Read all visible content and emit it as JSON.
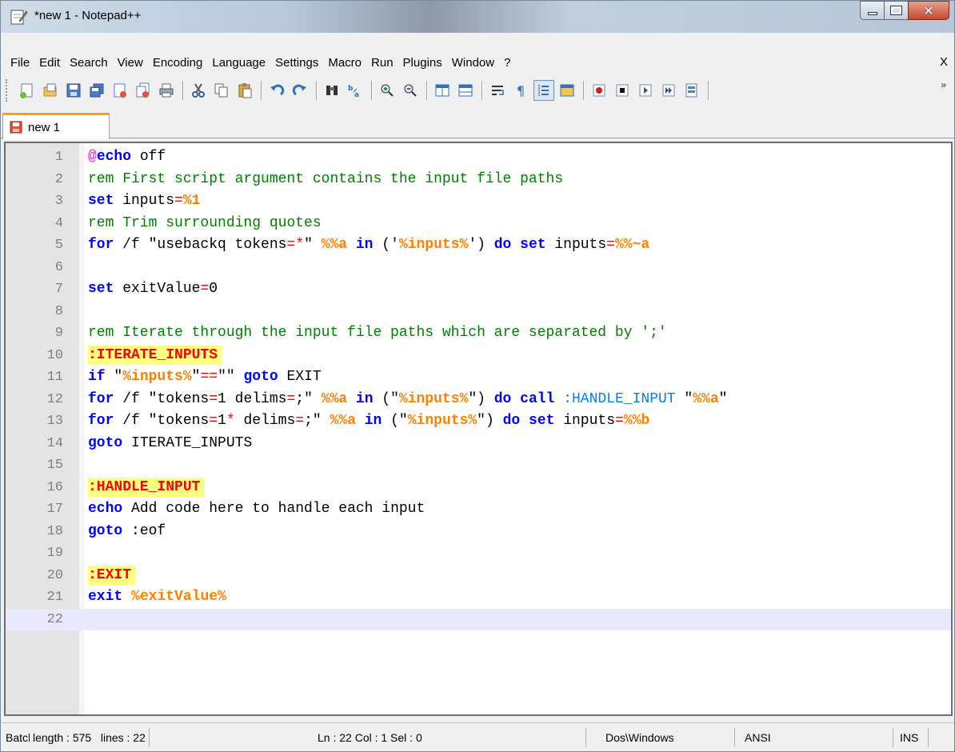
{
  "window": {
    "title": "*new 1 - Notepad++"
  },
  "menu": {
    "items": [
      "File",
      "Edit",
      "Search",
      "View",
      "Encoding",
      "Language",
      "Settings",
      "Macro",
      "Run",
      "Plugins",
      "Window",
      "?"
    ],
    "close": "X"
  },
  "toolbar": {
    "icons": [
      "new-file-icon",
      "open-file-icon",
      "save-icon",
      "save-all-icon",
      "close-icon",
      "close-all-icon",
      "print-icon",
      "cut-icon",
      "copy-icon",
      "paste-icon",
      "undo-icon",
      "redo-icon",
      "find-icon",
      "replace-icon",
      "zoom-in-icon",
      "zoom-out-icon",
      "sync-vertical-icon",
      "sync-horizontal-icon",
      "word-wrap-icon",
      "show-all-chars-icon",
      "indent-guide-icon",
      "document-map-icon",
      "record-macro-icon",
      "stop-record-icon",
      "playback-macro-icon",
      "run-macro-multiple-icon",
      "save-macro-icon"
    ],
    "more": "»"
  },
  "tab": {
    "label": "new 1"
  },
  "editor": {
    "lines": [
      {
        "n": "1"
      },
      {
        "n": "2"
      },
      {
        "n": "3"
      },
      {
        "n": "4"
      },
      {
        "n": "5"
      },
      {
        "n": "6"
      },
      {
        "n": "7"
      },
      {
        "n": "8"
      },
      {
        "n": "9"
      },
      {
        "n": "10"
      },
      {
        "n": "11"
      },
      {
        "n": "12"
      },
      {
        "n": "13"
      },
      {
        "n": "14"
      },
      {
        "n": "15"
      },
      {
        "n": "16"
      },
      {
        "n": "17"
      },
      {
        "n": "18"
      },
      {
        "n": "19"
      },
      {
        "n": "20"
      },
      {
        "n": "21"
      },
      {
        "n": "22"
      }
    ],
    "code": {
      "l1_at": "@",
      "l1_kw": "echo",
      "l1_rest": " off",
      "l2": "rem First script argument contains the input file paths",
      "l3_kw": "set",
      "l3_a": " inputs",
      "l3_op": "=",
      "l3_var": "%1",
      "l4": "rem Trim surrounding quotes",
      "l5_kw1": "for",
      "l5_a": " /f \"usebackq tokens",
      "l5_op1": "=*",
      "l5_b": "\" ",
      "l5_var1": "%%a",
      "l5_kw2": " in",
      "l5_c": " ('",
      "l5_var2": "%inputs%",
      "l5_d": "') ",
      "l5_kw3": "do",
      "l5_sp": " ",
      "l5_kw4": "set",
      "l5_e": " inputs",
      "l5_op2": "=",
      "l5_var3": "%%~a",
      "l7_kw": "set",
      "l7_a": " exitValue",
      "l7_op": "=",
      "l7_b": "0",
      "l9": "rem Iterate through the input file paths which are separated by ';'",
      "l10": ":ITERATE_INPUTS",
      "l11_kw1": "if",
      "l11_a": " \"",
      "l11_var": "%inputs%",
      "l11_b": "\"",
      "l11_op": "==",
      "l11_c": "\"\" ",
      "l11_kw2": "goto",
      "l11_d": " EXIT",
      "l12_kw1": "for",
      "l12_a": " /f \"tokens",
      "l12_op": "=",
      "l12_b": "1 delims",
      "l12_op2": "=",
      "l12_c": ";\" ",
      "l12_var1": "%%a",
      "l12_kw2": " in",
      "l12_d": " (\"",
      "l12_var2": "%inputs%",
      "l12_e": "\") ",
      "l12_kw3": "do",
      "l12_sp": " ",
      "l12_kw4": "call",
      "l12_sp2": " ",
      "l12_lbl": ":HANDLE_INPUT",
      "l12_f": " \"",
      "l12_var3": "%%a",
      "l12_g": "\"",
      "l13_kw1": "for",
      "l13_a": " /f \"tokens",
      "l13_op": "=",
      "l13_b": "1",
      "l13_op2": "*",
      "l13_c": " delims",
      "l13_op3": "=",
      "l13_d": ";\" ",
      "l13_var1": "%%a",
      "l13_kw2": " in",
      "l13_e": " (\"",
      "l13_var2": "%inputs%",
      "l13_f": "\") ",
      "l13_kw3": "do",
      "l13_sp": " ",
      "l13_kw4": "set",
      "l13_g": " inputs",
      "l13_op4": "=",
      "l13_var3": "%%b",
      "l14_kw": "goto",
      "l14_a": " ITERATE_INPUTS",
      "l16": ":HANDLE_INPUT",
      "l17_kw": "echo",
      "l17_a": " Add code here to handle each input",
      "l18_kw": "goto",
      "l18_a": " :eof",
      "l20": ":EXIT",
      "l21_kw": "exit",
      "l21_sp": " ",
      "l21_var": "%exitValue%"
    }
  },
  "status": {
    "type": "Batch file",
    "length": "length : 575",
    "lines": "lines : 22",
    "position": "Ln : 22   Col : 1   Sel : 0",
    "eol": "Dos\\Windows",
    "encoding": "ANSI",
    "mode": "INS"
  },
  "colors": {
    "comment": "#008000",
    "keyword": "#0000ff",
    "operator": "#ff0000",
    "variable": "#ff8000",
    "label_bg": "#ffff80",
    "current_line": "#e8e8ff",
    "tab_accent": "#f7a21b"
  }
}
